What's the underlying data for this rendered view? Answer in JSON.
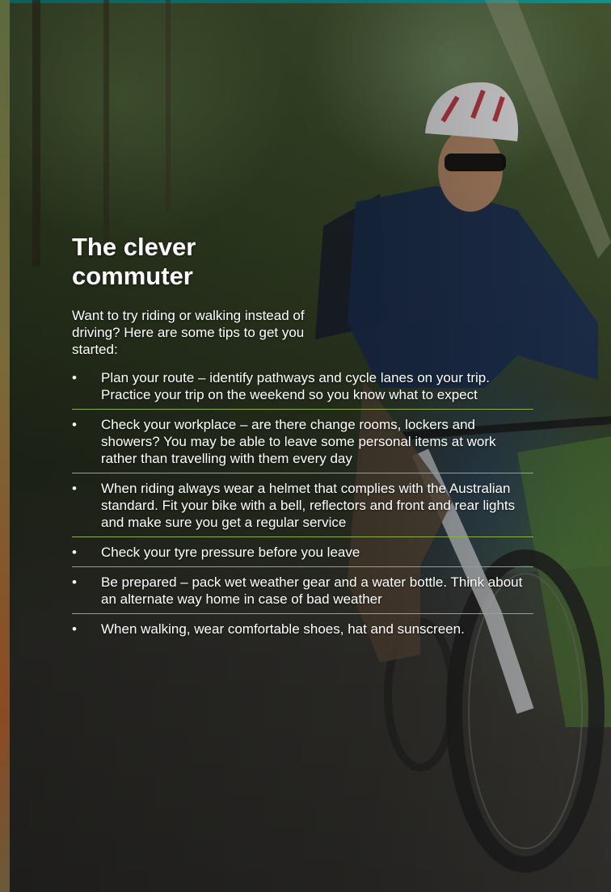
{
  "colors": {
    "accent_stripe": "#11a7a1",
    "divider": "#8fb14a",
    "text": "#ffffff"
  },
  "title": "The clever commuter",
  "intro": "Want to try riding or walking instead of driving? Here are some tips to get you started:",
  "bullet_glyph": "•",
  "tips": [
    "Plan your route – identify pathways and cycle lanes on your trip. Practice your trip on the weekend so you know what to expect",
    "Check your workplace – are there change rooms, lockers and showers? You may be able to leave some personal items at work rather than travelling with them every day",
    "When riding always wear a helmet that complies with the Australian standard. Fit your bike with a bell, reflectors and front and rear lights and make sure you get a regular service",
    "Check your tyre pressure before you leave",
    "Be prepared – pack wet weather gear and a water bottle. Think about an alternate way home in case of bad weather",
    "When walking, wear comfortable shoes, hat and sunscreen."
  ]
}
